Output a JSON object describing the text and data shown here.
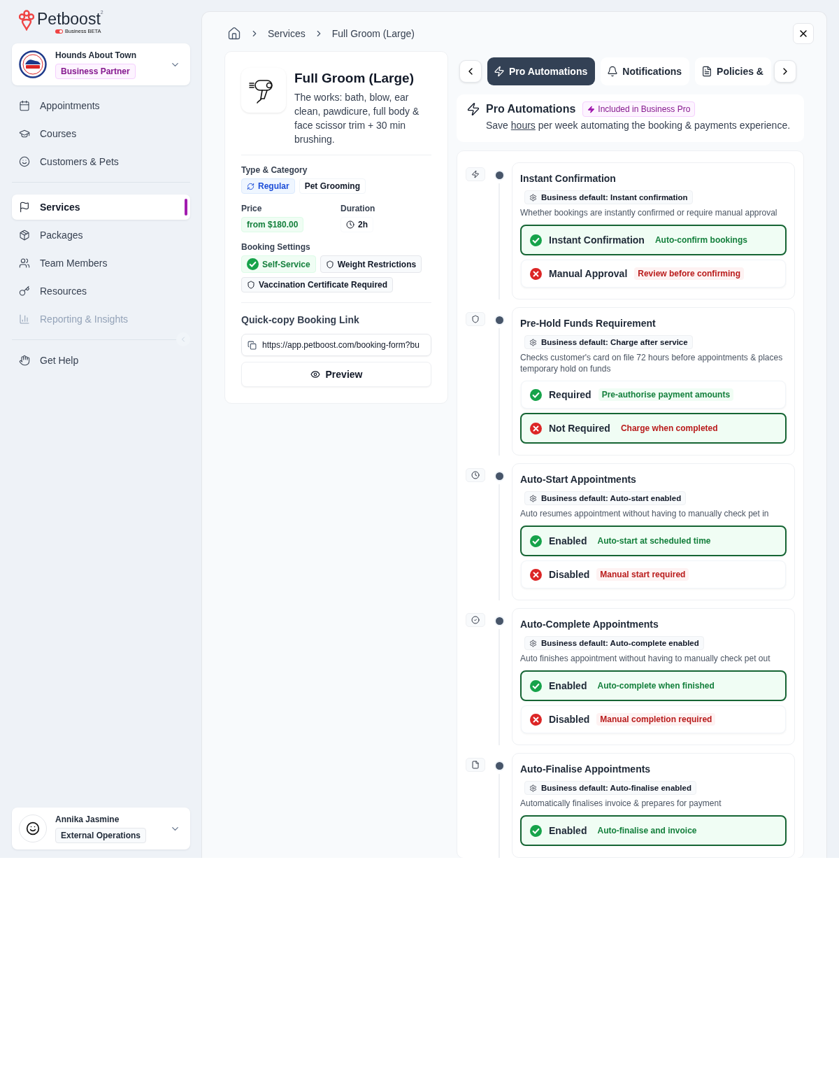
{
  "sidebar": {
    "logo": {
      "name": "Petboost",
      "mark": "2",
      "tagline": "Business BETA"
    },
    "business": {
      "name": "Hounds About Town",
      "badge": "Business Partner"
    },
    "nav_groups": [
      [
        {
          "label": "Appointments",
          "selected": false,
          "disabled": false
        },
        {
          "label": "Courses",
          "selected": false,
          "disabled": false
        },
        {
          "label": "Customers & Pets",
          "selected": false,
          "disabled": false
        }
      ],
      [
        {
          "label": "Services",
          "selected": true,
          "disabled": false
        },
        {
          "label": "Packages",
          "selected": false,
          "disabled": false
        },
        {
          "label": "Team Members",
          "selected": false,
          "disabled": false
        },
        {
          "label": "Resources",
          "selected": false,
          "disabled": false
        },
        {
          "label": "Reporting & Insights",
          "selected": false,
          "disabled": true
        }
      ],
      [
        {
          "label": "Get Help",
          "selected": false,
          "disabled": false
        }
      ]
    ],
    "user": {
      "name": "Annika Jasmine",
      "role": "External Operations"
    }
  },
  "breadcrumb": [
    "Services",
    "Full Groom (Large)"
  ],
  "service": {
    "title": "Full Groom (Large)",
    "description": "The works: bath, blow, ear clean, pawdicure, full body & face scissor trim + 30 min brushing.",
    "type_label": "Type & Category",
    "tags": [
      {
        "label": "Regular",
        "kind": "type"
      },
      {
        "label": "Pet Grooming",
        "kind": "category"
      }
    ],
    "price_label": "Price",
    "price": "from $180.00",
    "duration_label": "Duration",
    "duration": "2h",
    "booking_label": "Booking Settings",
    "settings": [
      {
        "label": "Self-Service",
        "kind": "enabled"
      },
      {
        "label": "Weight Restrictions",
        "kind": "restriction"
      },
      {
        "label": "Vaccination Certificate Required",
        "kind": "restriction"
      }
    ],
    "link_title": "Quick-copy Booking Link",
    "link_url": "https://app.petboost.com/booking-form?bu",
    "preview": "Preview"
  },
  "tabs": [
    {
      "label": "Pro Automations",
      "selected": true
    },
    {
      "label": "Notifications",
      "selected": false
    },
    {
      "label": "Policies &",
      "selected": false
    }
  ],
  "automations": {
    "title": "Pro Automations",
    "badge": "Included in Business Pro",
    "subtitle": {
      "before": "Save",
      "link": "hours",
      "after": "per week automating the booking & payments experience."
    },
    "sections": [
      {
        "title": "Instant Confirmation",
        "default": "Business default: Instant confirmation",
        "description": "Whether bookings are instantly confirmed or require manual approval",
        "options": [
          {
            "label": "Instant Confirmation",
            "note": "Auto-confirm bookings",
            "kind": "positive",
            "selected": true
          },
          {
            "label": "Manual Approval",
            "note": "Review before confirming",
            "kind": "negative",
            "selected": false
          }
        ]
      },
      {
        "title": "Pre-Hold Funds Requirement",
        "default": "Business default: Charge after service",
        "description": "Checks customer's card on file 72 hours before appointments & places temporary hold on funds",
        "options": [
          {
            "label": "Required",
            "note": "Pre-authorise payment amounts",
            "kind": "positive",
            "selected": false
          },
          {
            "label": "Not Required",
            "note": "Charge when completed",
            "kind": "negative",
            "selected": true
          }
        ]
      },
      {
        "title": "Auto-Start Appointments",
        "default": "Business default: Auto-start enabled",
        "description": "Auto resumes appointment without having to manually check pet in",
        "options": [
          {
            "label": "Enabled",
            "note": "Auto-start at scheduled time",
            "kind": "positive",
            "selected": true
          },
          {
            "label": "Disabled",
            "note": "Manual start required",
            "kind": "negative",
            "selected": false
          }
        ]
      },
      {
        "title": "Auto-Complete Appointments",
        "default": "Business default: Auto-complete enabled",
        "description": "Auto finishes appointment without having to manually check pet out",
        "options": [
          {
            "label": "Enabled",
            "note": "Auto-complete when finished",
            "kind": "positive",
            "selected": true
          },
          {
            "label": "Disabled",
            "note": "Manual completion required",
            "kind": "negative",
            "selected": false
          }
        ]
      },
      {
        "title": "Auto-Finalise Appointments",
        "default": "Business default: Auto-finalise enabled",
        "description": "Automatically finalises invoice & prepares for payment",
        "options": [
          {
            "label": "Enabled",
            "note": "Auto-finalise and invoice",
            "kind": "positive",
            "selected": true
          }
        ]
      }
    ]
  }
}
